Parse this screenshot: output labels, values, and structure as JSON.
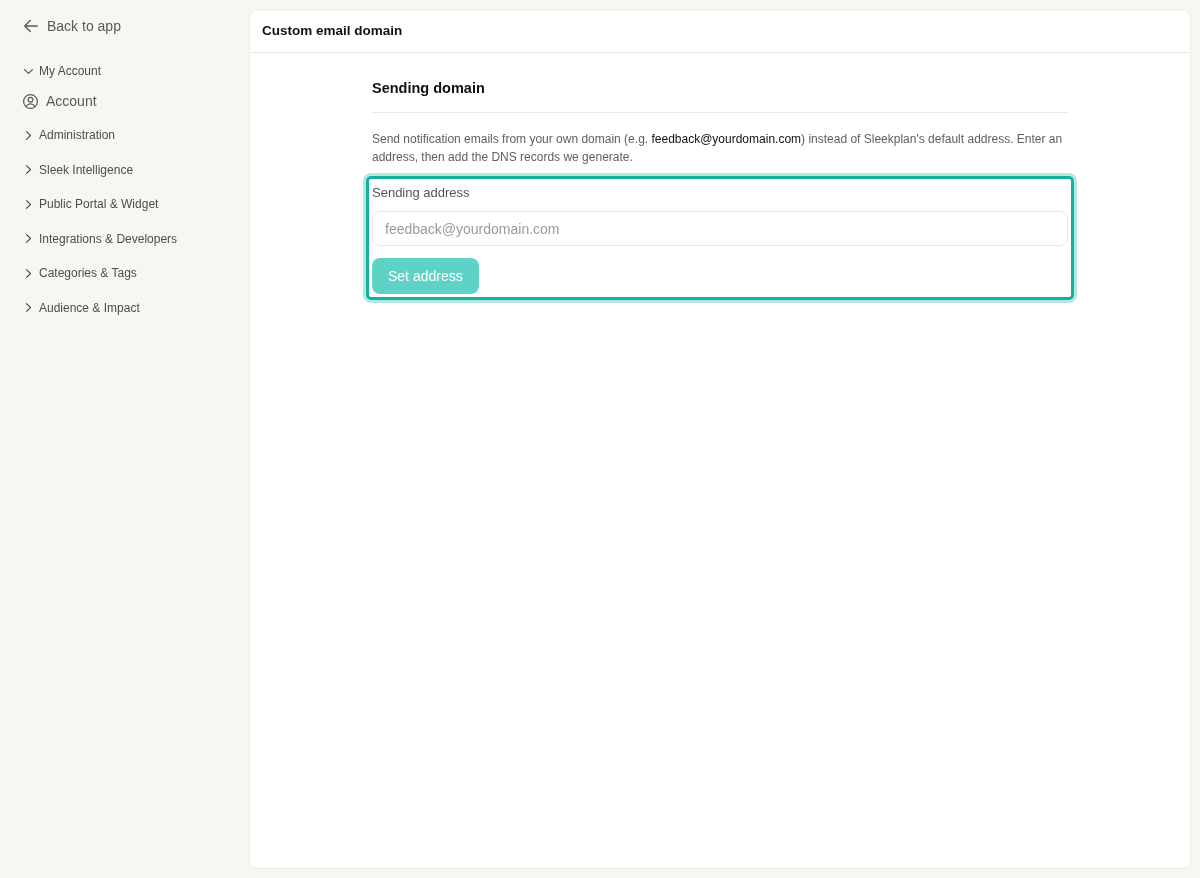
{
  "sidebar": {
    "back_link": "Back to app",
    "groups": [
      {
        "label": "My Account",
        "expanded": true,
        "items": [
          {
            "label": "Account",
            "selected": false
          }
        ]
      },
      {
        "label": "Administration",
        "expanded": false
      },
      {
        "label": "Sleek Intelligence",
        "expanded": false
      },
      {
        "label": "Public Portal & Widget",
        "expanded": false
      },
      {
        "label": "Integrations & Developers",
        "expanded": false
      },
      {
        "label": "Categories & Tags",
        "expanded": false
      },
      {
        "label": "Audience & Impact",
        "expanded": false
      }
    ]
  },
  "panel": {
    "title": "Custom email domain",
    "section": {
      "title": "Sending domain",
      "description": "Send notification emails from your own domain (e.g. **feedback@yourdomain.com**) instead of Sleekplan's default address. Enter an address, then add the DNS records we generate.",
      "form": {
        "highlighted": true,
        "label": "Sending address",
        "placeholder": "feedback@yourdomain.com",
        "button": {
          "label": "Set address",
          "disabled": true
        }
      }
    }
  }
}
